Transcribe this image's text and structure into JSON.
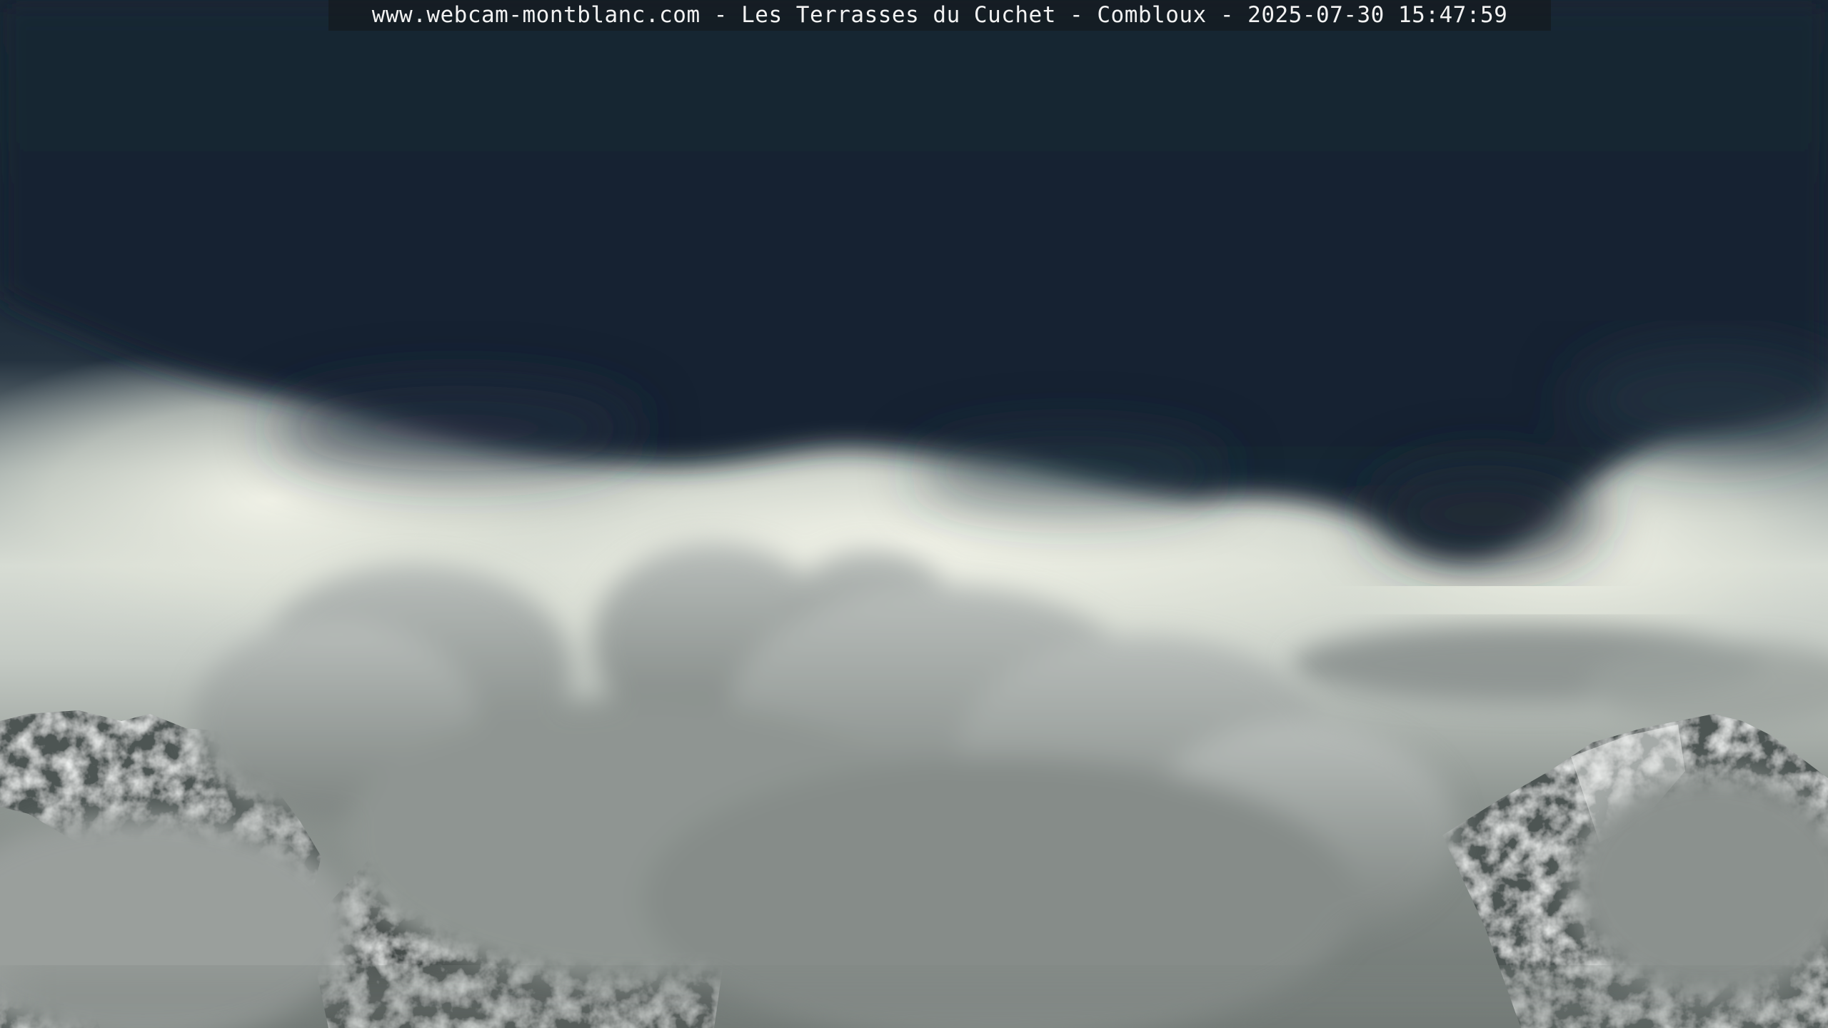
{
  "webcam": {
    "caption": "www.webcam-montblanc.com - Les Terrasses du Cuchet - Combloux - 2025-07-30 15:47:59"
  },
  "colors": {
    "storm_cloud": "#17232f",
    "bright_sky": "#e3e6dc",
    "cumulus": "#a9aeab",
    "rock": "#4a514f",
    "snow": "#eef1ef"
  }
}
